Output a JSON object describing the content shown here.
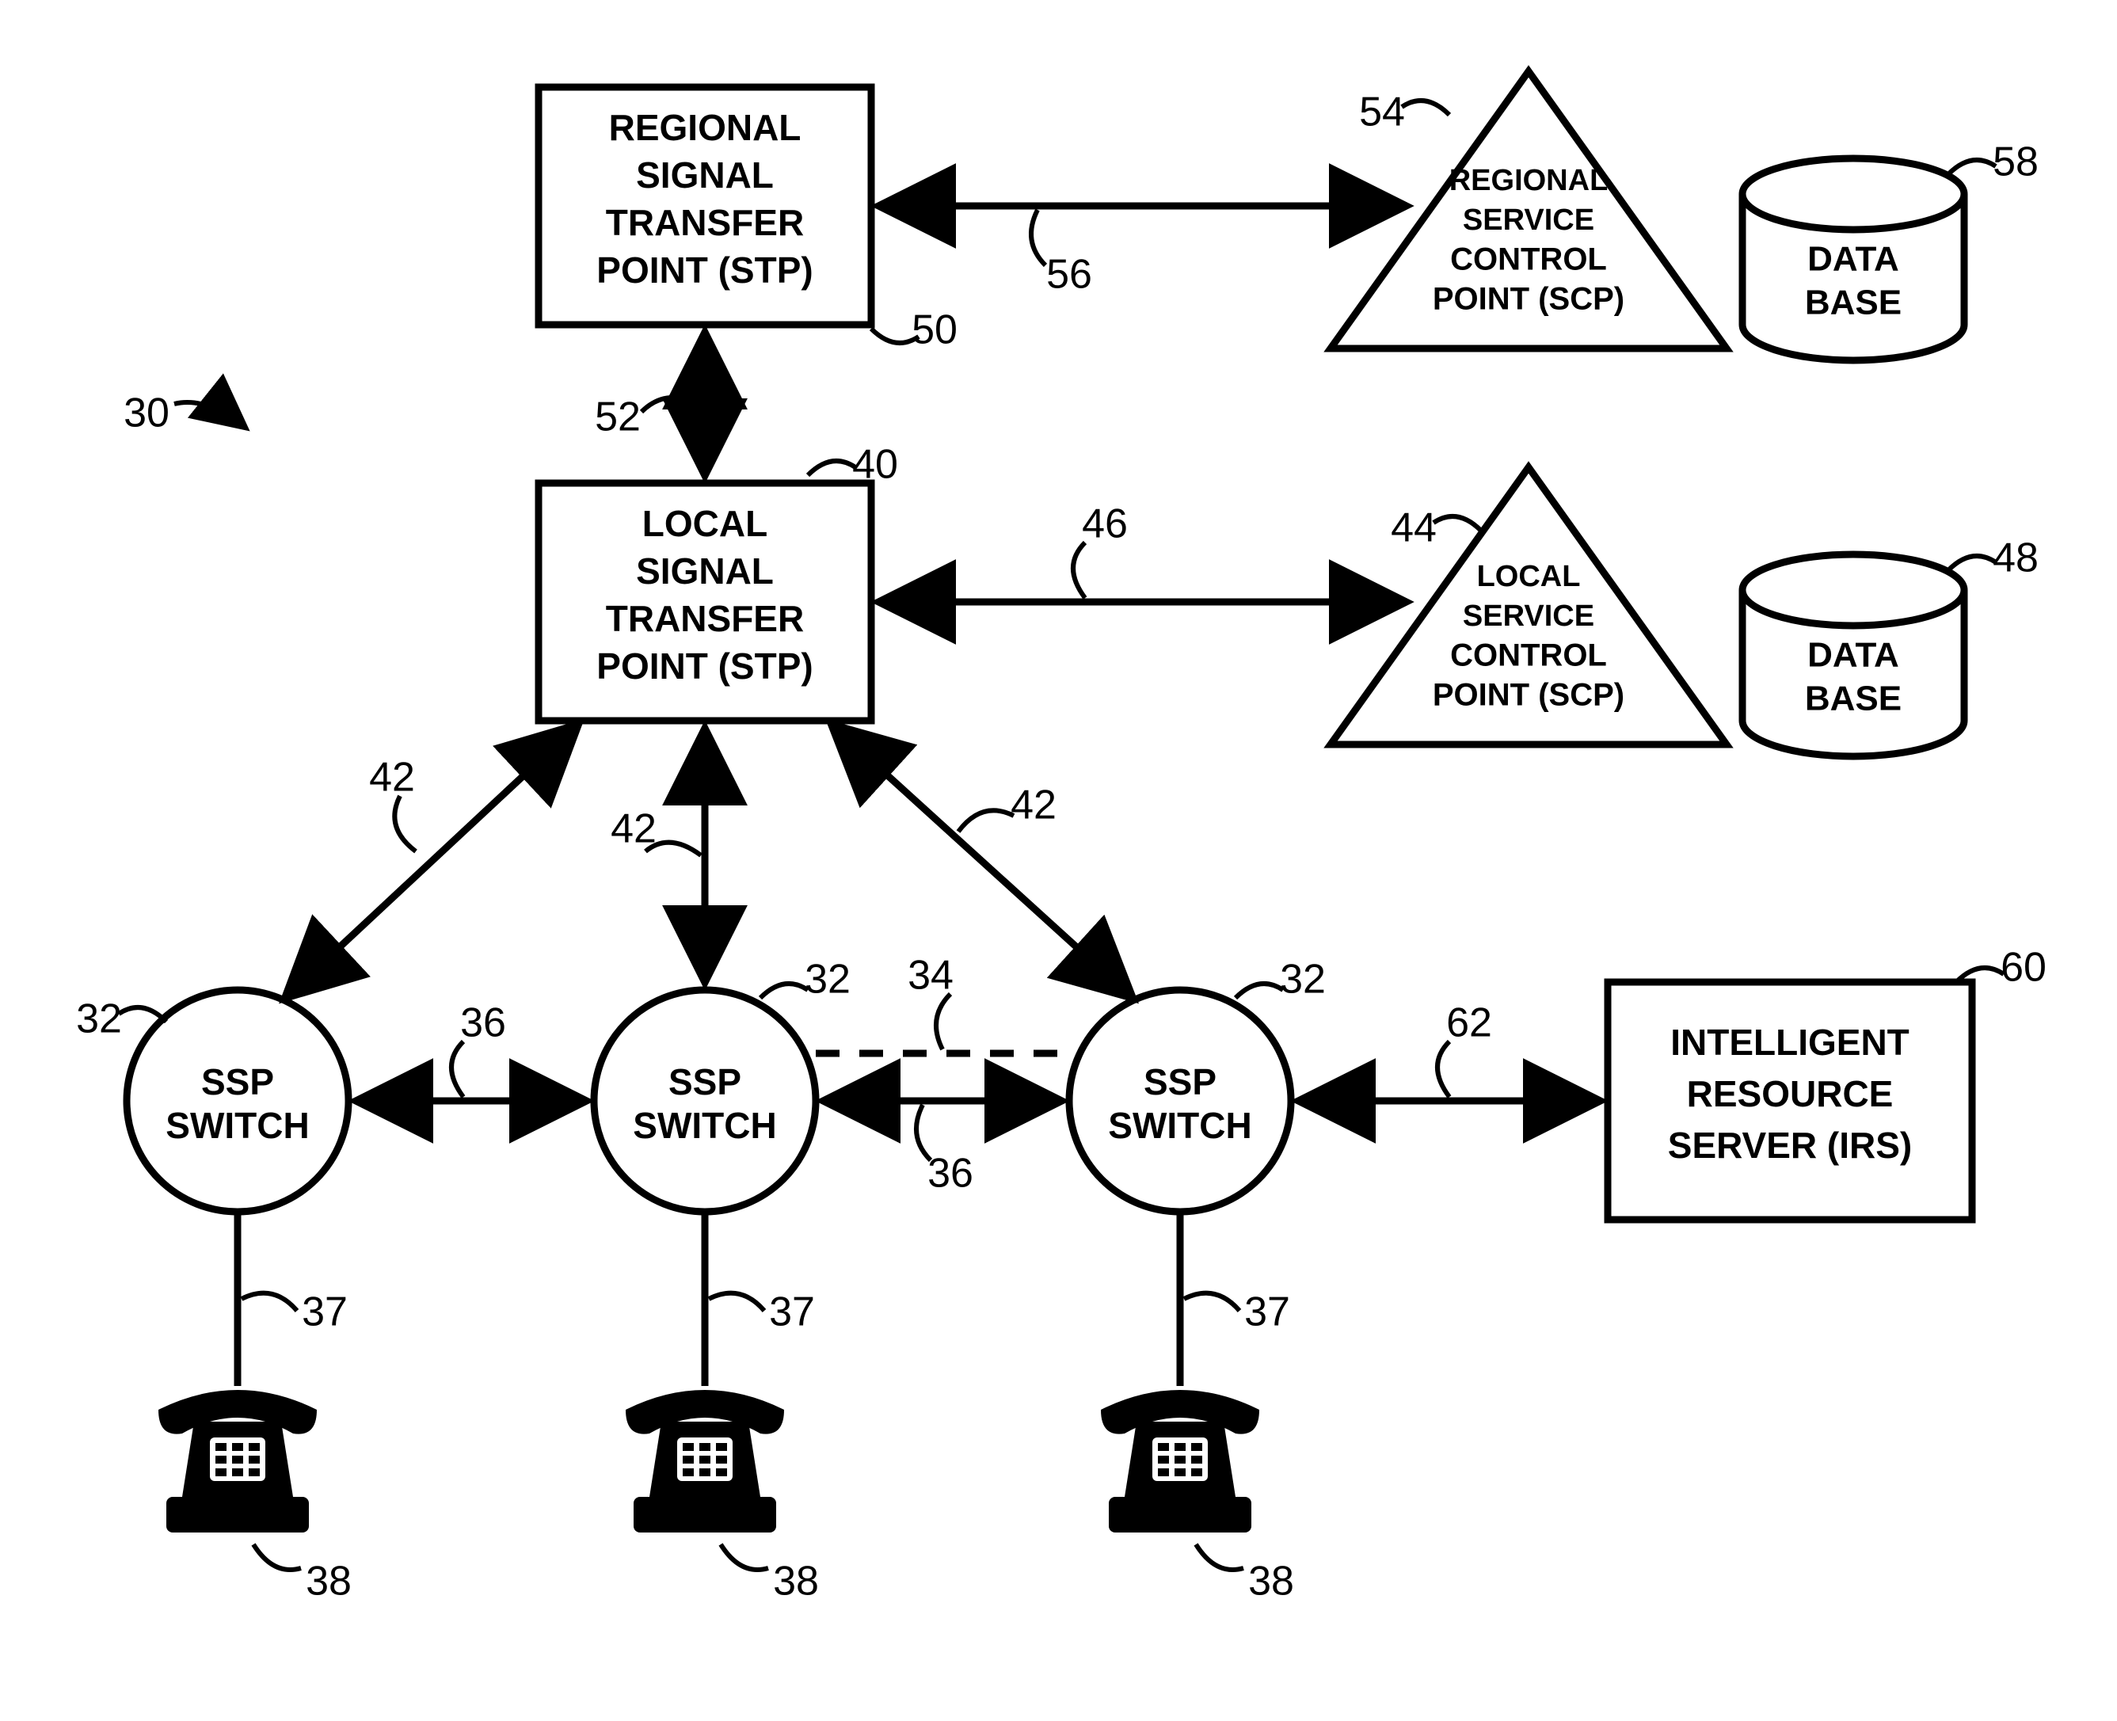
{
  "diagram": {
    "figure_number": "30",
    "regional_stp": {
      "line1": "REGIONAL",
      "line2": "SIGNAL",
      "line3": "TRANSFER",
      "line4": "POINT (STP)",
      "ref": "50"
    },
    "regional_scp": {
      "line1": "REGIONAL",
      "line2": "SERVICE",
      "line3": "CONTROL",
      "line4": "POINT (SCP)",
      "ref": "54"
    },
    "regional_db": {
      "line1": "DATA",
      "line2": "BASE",
      "ref": "58"
    },
    "link_rstp_rscp": "56",
    "link_rstp_lstp": "52",
    "local_stp": {
      "line1": "LOCAL",
      "line2": "SIGNAL",
      "line3": "TRANSFER",
      "line4": "POINT (STP)",
      "ref": "40"
    },
    "local_scp": {
      "line1": "LOCAL",
      "line2": "SERVICE",
      "line3": "CONTROL",
      "line4": "POINT (SCP)",
      "ref": "44"
    },
    "local_db": {
      "line1": "DATA",
      "line2": "BASE",
      "ref": "48"
    },
    "link_lstp_lscp": "46",
    "link_lstp_ssp": "42",
    "ssp": {
      "line1": "SSP",
      "line2": "SWITCH",
      "ref": "32"
    },
    "link_ssp_ssp": "36",
    "link_ssp_dashed": "34",
    "link_ssp_phone": "37",
    "phone_ref": "38",
    "irs": {
      "line1": "INTELLIGENT",
      "line2": "RESOURCE",
      "line3": "SERVER (IRS)",
      "ref": "60"
    },
    "link_ssp_irs": "62"
  }
}
